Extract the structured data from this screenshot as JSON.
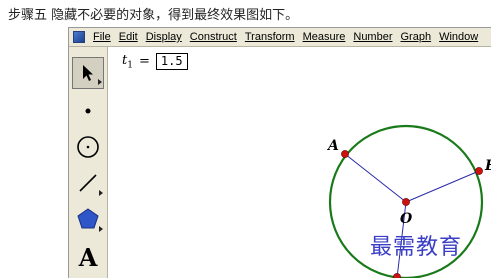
{
  "caption": "步骤五 隐藏不必要的对象，得到最终效果图如下。",
  "menu": [
    "File",
    "Edit",
    "Display",
    "Construct",
    "Transform",
    "Measure",
    "Number",
    "Graph",
    "Window"
  ],
  "tools": [
    {
      "name": "arrow-select-tool",
      "icon": "arrow-icon"
    },
    {
      "name": "point-tool",
      "icon": "point-icon"
    },
    {
      "name": "compass-tool",
      "icon": "circle-icon"
    },
    {
      "name": "straightedge-tool",
      "icon": "segment-icon"
    },
    {
      "name": "polygon-tool",
      "icon": "pentagon-icon"
    },
    {
      "name": "text-tool",
      "icon": "text-A-icon",
      "glyph": "A"
    }
  ],
  "parameter": {
    "name": "t",
    "subscript": "1",
    "equals": "=",
    "value": "1.5"
  },
  "points": {
    "A": "A",
    "E": "E",
    "O": "O"
  },
  "watermark": "最需教育",
  "colors": {
    "circle": "#1a7a1a",
    "segment": "#2a2aa8",
    "point": "#cc1111",
    "watermark": "#3b3fc6"
  }
}
